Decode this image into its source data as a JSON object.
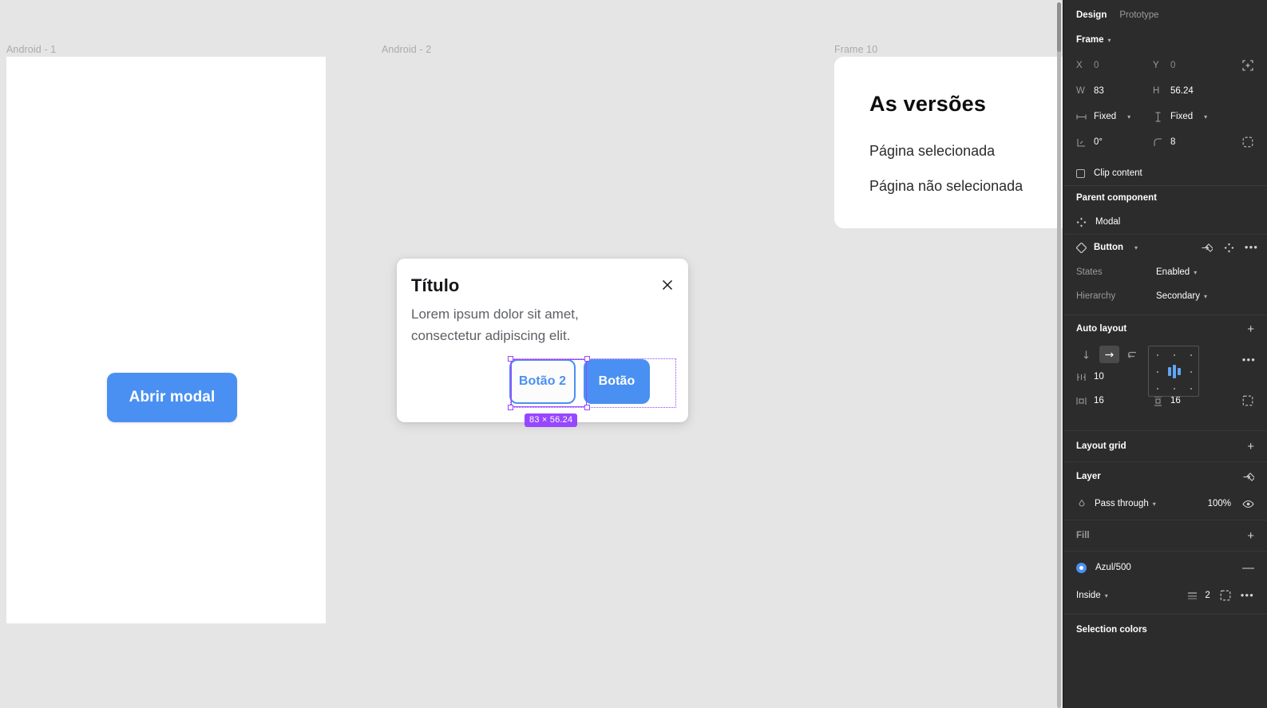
{
  "canvas": {
    "background_color": "#e5e5e5",
    "frames": [
      {
        "label": "Android - 1"
      },
      {
        "label": "Android - 2"
      },
      {
        "label": "Frame 10"
      }
    ],
    "android1": {
      "button_label": "Abrir modal"
    },
    "modal": {
      "title": "Título",
      "body": "Lorem ipsum dolor sit amet, consectetur adipiscing elit.",
      "close_icon": "close-icon",
      "buttons": [
        {
          "label": "Botão 2",
          "style": "secondary"
        },
        {
          "label": "Botão",
          "style": "primary"
        }
      ]
    },
    "selection": {
      "size_badge": "83 × 56.24",
      "badge_color": "#9747ff"
    },
    "frame10": {
      "title": "As versões",
      "line1": "Página selecionada",
      "line2": "Página não selecionada"
    },
    "colors": {
      "primary_blue": "#4a90f2",
      "selection_purple": "#9747ff"
    }
  },
  "panel": {
    "tabs": {
      "design": "Design",
      "prototype": "Prototype",
      "active": "Design"
    },
    "frame_section": {
      "title": "Frame",
      "x_label": "X",
      "x_value": "0",
      "y_label": "Y",
      "y_value": "0",
      "w_label": "W",
      "w_value": "83",
      "h_label": "H",
      "h_value": "56.24",
      "horizontal_resizing": "Fixed",
      "vertical_resizing": "Fixed",
      "rotation": "0°",
      "corner_radius": "8",
      "clip_content": "Clip content"
    },
    "parent_component": {
      "title": "Parent component",
      "name": "Modal"
    },
    "component": {
      "name": "Button",
      "properties": [
        {
          "key": "States",
          "value": "Enabled"
        },
        {
          "key": "Hierarchy",
          "value": "Secondary"
        }
      ]
    },
    "auto_layout": {
      "title": "Auto layout",
      "direction": "horizontal",
      "gap": "10",
      "padding_horizontal": "16",
      "padding_vertical": "16"
    },
    "layout_grid": {
      "title": "Layout grid"
    },
    "layer": {
      "title": "Layer",
      "blend_mode": "Pass through",
      "opacity": "100%"
    },
    "fill": {
      "title": "Fill"
    },
    "stroke": {
      "color_name": "Azul/500",
      "color_hex": "#4a90f2",
      "alignment": "Inside",
      "weight": "2"
    },
    "selection_colors": {
      "title": "Selection colors"
    }
  }
}
